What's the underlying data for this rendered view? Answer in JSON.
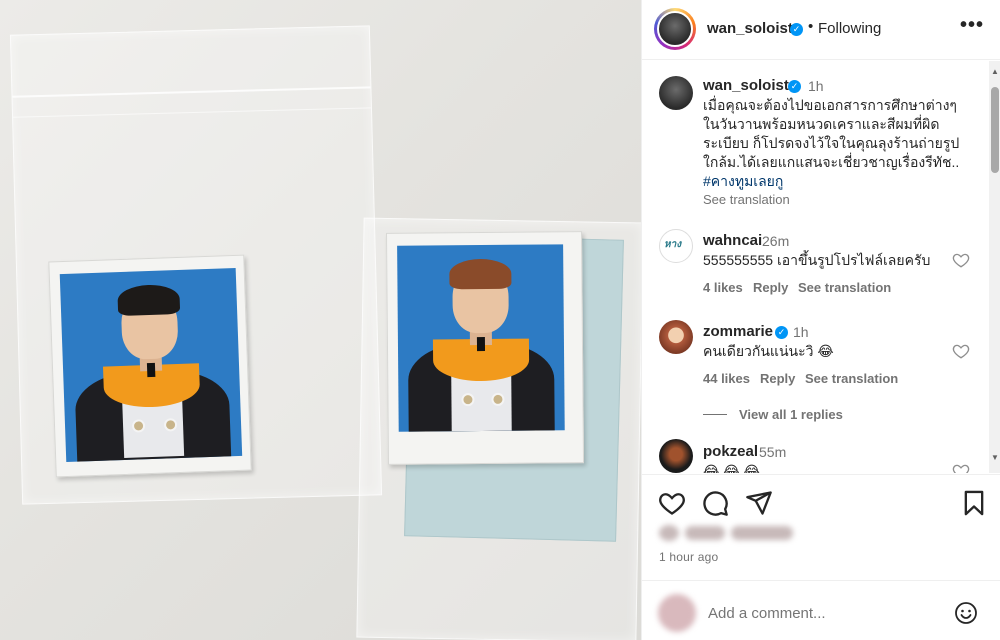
{
  "post": {
    "username": "wan_soloist",
    "following_label": "Following",
    "more_label": "•••",
    "caption": {
      "time": "1h",
      "lines": [
        "เมื่อคุณจะต้องไปขอเอกสารการศึกษาต่างๆ",
        "ในวันวานพร้อมหนวดเคราและสีผมที่ผิด",
        "ระเบียบ ก็โปรดจงไว้ใจในคุณลุงร้านถ่ายรูป",
        "ใกล้ม.ได้เลยแกแสนจะเชี่ยวชาญเรื่องรีทัช.."
      ],
      "hashtag": "#คางทูมเลยกู",
      "see_translation": "See translation"
    },
    "comments": [
      {
        "username": "wahncai",
        "avatar_text": "หาง",
        "time": "26m",
        "text": "555555555 เอาขึ้นรูปโปรไฟล์เลยครับ",
        "likes": "4 likes",
        "reply": "Reply",
        "see_translation": "See translation"
      },
      {
        "username": "zommarie",
        "verified": true,
        "time": "1h",
        "text": "คนเดียวกันแน่นะวิ 😂",
        "likes": "44 likes",
        "reply": "Reply",
        "see_translation": "See translation",
        "view_replies": "View all 1 replies"
      },
      {
        "username": "pokzeal",
        "time": "55m",
        "text": "😂 😂 😂"
      }
    ],
    "posted_time": "1 hour ago",
    "add_comment_placeholder": "Add a comment...",
    "icons": {
      "like": "heart-icon",
      "comment": "comment-icon",
      "share": "share-icon",
      "save": "bookmark-icon",
      "emoji": "emoji-icon"
    },
    "colors": {
      "verified_blue": "#0095f6",
      "hashtag_link": "#00376b",
      "secondary_text": "#737373"
    }
  }
}
